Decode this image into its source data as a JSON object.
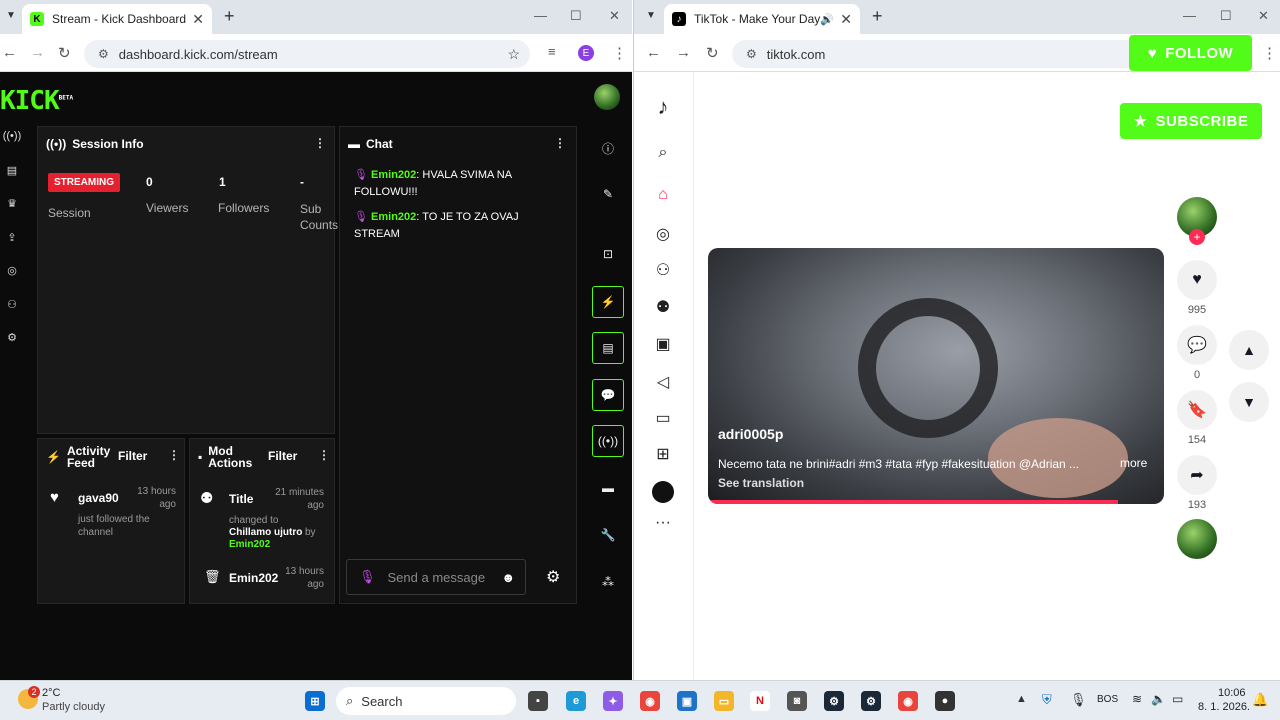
{
  "left_window": {
    "tab_title": "Stream - Kick Dashboard",
    "url": "dashboard.kick.com/stream",
    "profile_initial": "E",
    "logo": "KICK",
    "logo_badge": "BETA",
    "session": {
      "title": "Session Info",
      "status": "STREAMING",
      "session_label": "Session",
      "viewers_value": "0",
      "viewers_label": "Viewers",
      "followers_value": "1",
      "followers_label": "Followers",
      "subs_value": "-",
      "subs_label": "Sub Counts"
    },
    "chat": {
      "title": "Chat",
      "messages": [
        {
          "user": "Emin202",
          "text": ": HVALA SVIMA NA FOLLOWU!!!"
        },
        {
          "user": "Emin202",
          "text": ": TO JE TO ZA OVAJ STREAM"
        }
      ],
      "input_placeholder": "Send a message"
    },
    "activity": {
      "title": "Activity Feed",
      "filter": "Filter",
      "user": "gava90",
      "time": "13 hours ago",
      "desc": "just followed the channel"
    },
    "mod_actions": {
      "title": "Mod Actions",
      "filter": "Filter",
      "item1_title": "Title",
      "item1_time": "21 minutes ago",
      "item1_desc_a": "changed to",
      "item1_value": "Chillamo ujutro",
      "item1_by": "by",
      "item1_user": "Emin202",
      "item2_title": "Emin202",
      "item2_time": "13 hours ago"
    }
  },
  "right_window": {
    "tab_title": "TikTok - Make Your Day",
    "url": "tiktok.com",
    "follow_label": "FOLLOW",
    "subscribe_label": "SUBSCRIBE",
    "video": {
      "username": "adri0005p",
      "caption": "Necemo tata ne brini#adri #m3 #tata #fyp #fakesituation @Adrian ...",
      "more": "more",
      "see_translation": "See translation",
      "progress": 0.9
    },
    "actions": {
      "likes": "995",
      "comments": "0",
      "saves": "154",
      "shares": "193"
    }
  },
  "taskbar": {
    "weather_temp": "2°C",
    "weather_desc": "Partly cloudy",
    "weather_badge": "2",
    "search_label": "Search",
    "lang": "BOS",
    "time": "10:06",
    "date": "8. 1. 2026."
  },
  "colors": {
    "kick_green": "#53fc18",
    "streaming_red": "#e5202f",
    "tiktok_red": "#fe2c55"
  }
}
